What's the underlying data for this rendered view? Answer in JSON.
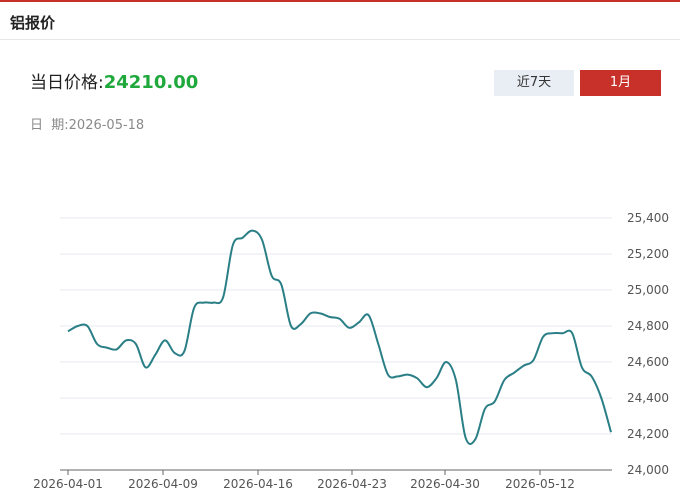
{
  "header": {
    "title": "铝报价"
  },
  "price": {
    "label": "当日价格:",
    "value": "24210.00"
  },
  "date": {
    "label": "日  期:",
    "value": "2026-05-18"
  },
  "buttons": {
    "week": "近7天",
    "month": "1月"
  },
  "colors": {
    "accent": "#c8302a",
    "price": "#1fa83c",
    "line": "#2a7f86",
    "grid": "#e4e8f0"
  },
  "chart_data": {
    "type": "line",
    "x_ticks": [
      "2026-04-01",
      "2026-04-09",
      "2026-04-16",
      "2026-04-23",
      "2026-04-30",
      "2026-05-12"
    ],
    "y_ticks": [
      "24,000",
      "24,200",
      "24,400",
      "24,600",
      "24,800",
      "25,000",
      "25,200",
      "25,400"
    ],
    "ylim": [
      24000,
      25400
    ],
    "grid": true,
    "series": [
      {
        "values": [
          24770,
          24800,
          24800,
          24700,
          24680,
          24670,
          24720,
          24700,
          24570,
          24640,
          24720,
          24650,
          24660,
          24900,
          24930,
          24930,
          24960,
          25250,
          25290,
          25330,
          25280,
          25080,
          25030,
          24800,
          24810,
          24870,
          24870,
          24850,
          24840,
          24790,
          24820,
          24860,
          24700,
          24530,
          24520,
          24530,
          24510,
          24460,
          24510,
          24600,
          24500,
          24180,
          24170,
          24340,
          24380,
          24500,
          24540,
          24580,
          24610,
          24740,
          24760,
          24760,
          24760,
          24570,
          24520,
          24400,
          24210
        ]
      }
    ]
  }
}
